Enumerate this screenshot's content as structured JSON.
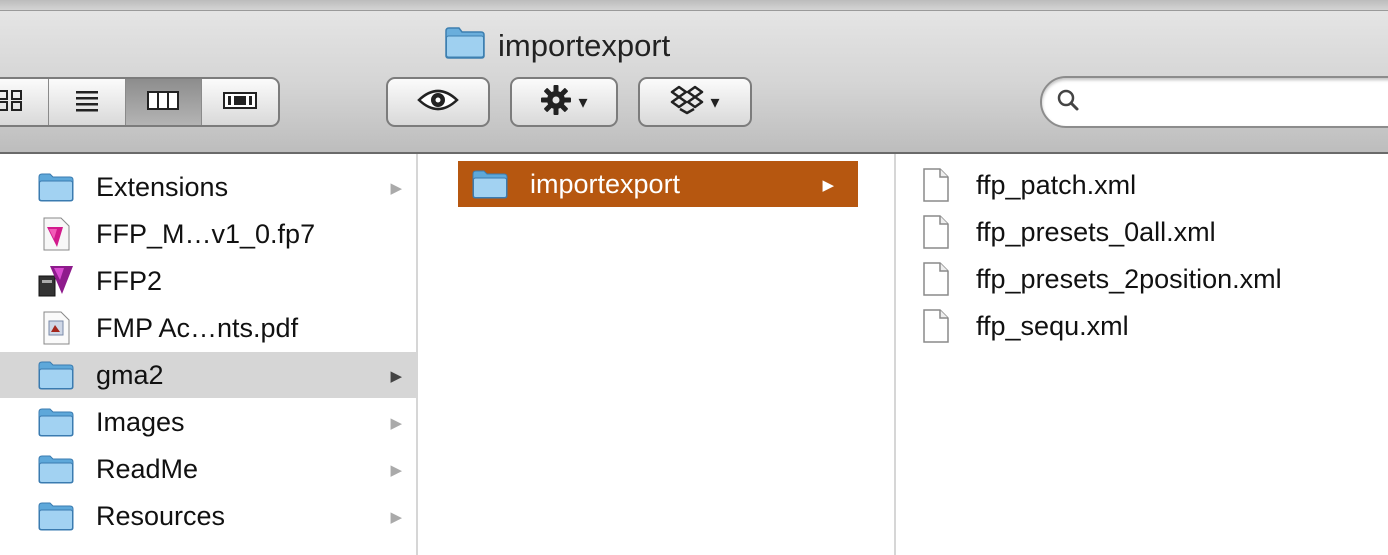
{
  "window": {
    "title": "importexport"
  },
  "search": {
    "placeholder": "",
    "value": ""
  },
  "column1": {
    "items": [
      {
        "label": "Extensions",
        "icon": "folder-icon",
        "arrow": "▶"
      },
      {
        "label": "FFP_M…v1_0.fp7",
        "icon": "filemaker-doc-icon",
        "arrow": ""
      },
      {
        "label": "FFP2",
        "icon": "filemaker-app-icon",
        "arrow": ""
      },
      {
        "label": "FMP Ac…nts.pdf",
        "icon": "pdf-icon",
        "arrow": ""
      },
      {
        "label": "gma2",
        "icon": "folder-icon",
        "arrow": "▶"
      },
      {
        "label": "Images",
        "icon": "folder-icon",
        "arrow": "▶"
      },
      {
        "label": "ReadMe",
        "icon": "folder-icon",
        "arrow": "▶"
      },
      {
        "label": "Resources",
        "icon": "folder-icon",
        "arrow": "▶"
      }
    ]
  },
  "column2": {
    "items": [
      {
        "label": "importexport",
        "icon": "folder-icon",
        "arrow": "▶"
      }
    ]
  },
  "column3": {
    "items": [
      {
        "label": "ffp_patch.xml",
        "icon": "document-icon"
      },
      {
        "label": "ffp_presets_0all.xml",
        "icon": "document-icon"
      },
      {
        "label": "ffp_presets_2position.xml",
        "icon": "document-icon"
      },
      {
        "label": "ffp_sequ.xml",
        "icon": "document-icon"
      }
    ]
  },
  "colors": {
    "selection": "#b65710",
    "inactive_selection": "#d6d6d6",
    "folder": "#6aaedc"
  }
}
